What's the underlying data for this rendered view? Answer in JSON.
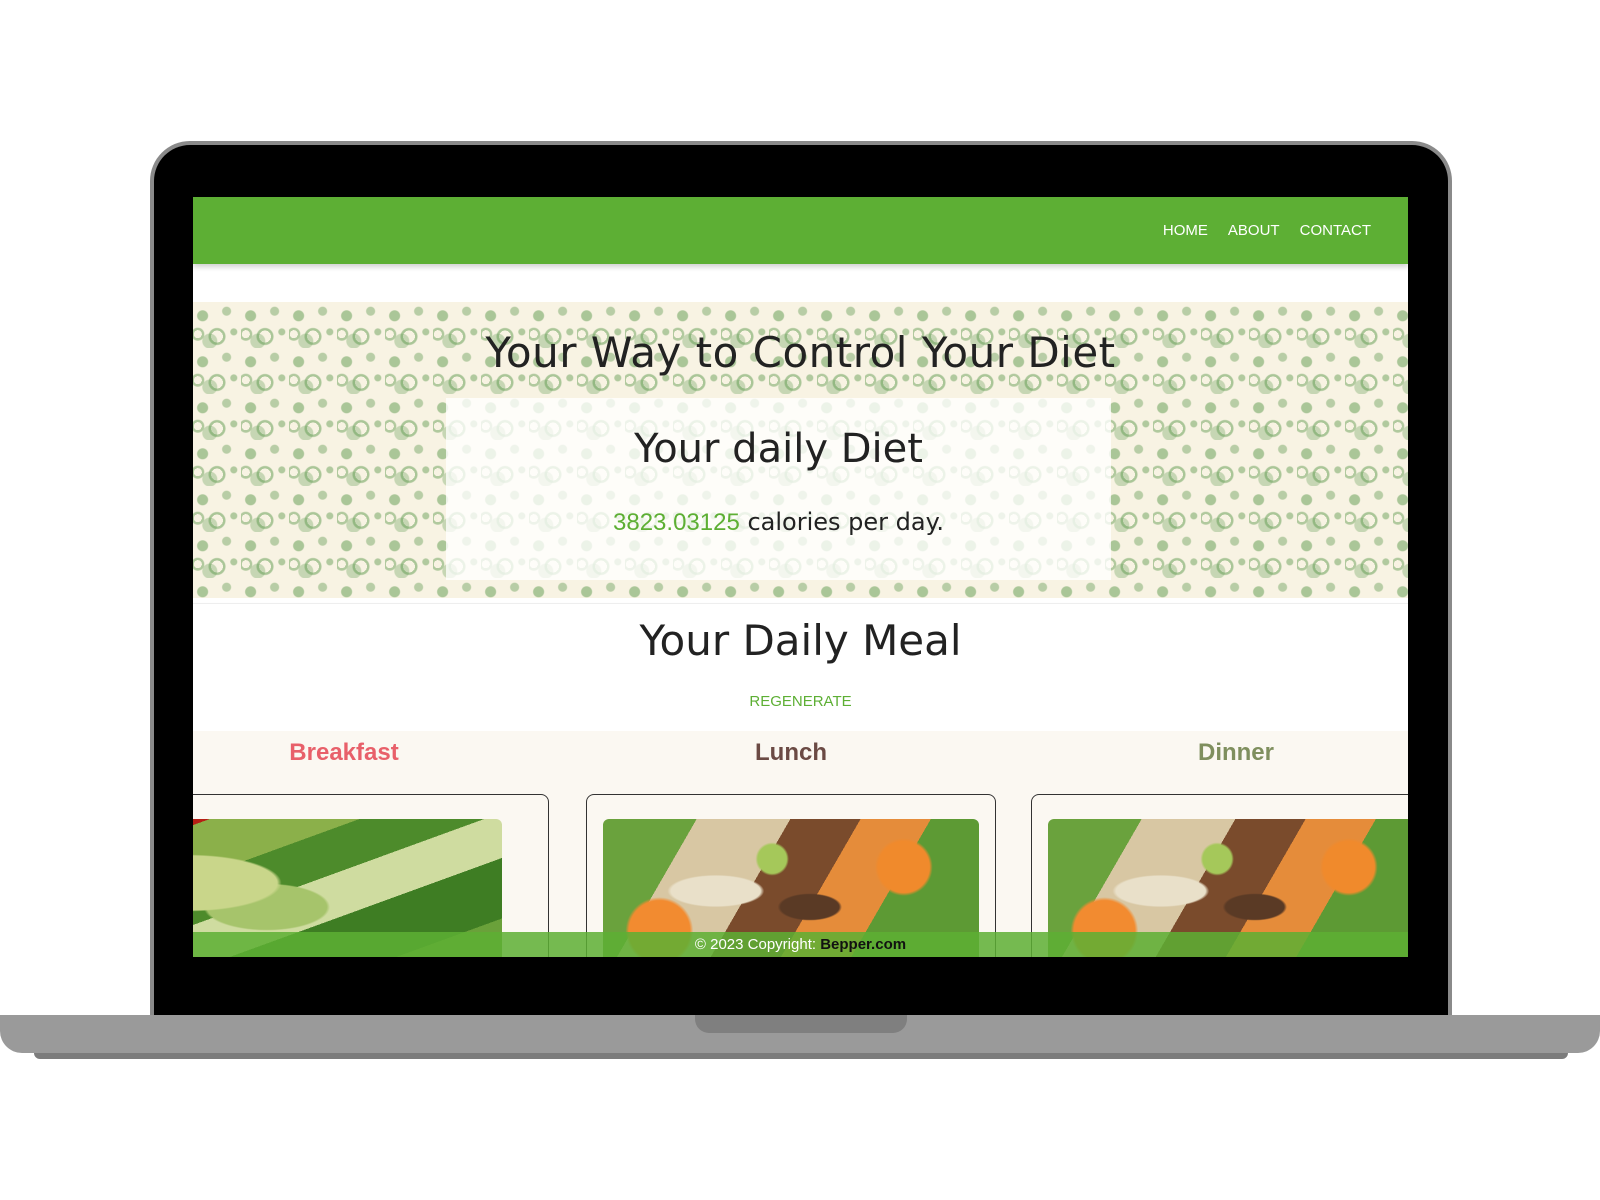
{
  "nav": {
    "items": [
      {
        "label": "HOME"
      },
      {
        "label": "ABOUT"
      },
      {
        "label": "CONTACT"
      }
    ]
  },
  "hero": {
    "title": "Your Way to Control Your Diet",
    "card": {
      "title": "Your daily Diet",
      "calories": "3823.03125",
      "calories_suffix": " calories per day."
    }
  },
  "meal_section": {
    "title": "Your Daily Meal",
    "regenerate_label": "REGENERATE"
  },
  "meals": [
    {
      "label": "Breakfast",
      "color": "#e8606a"
    },
    {
      "label": "Lunch",
      "color": "#6b4a44"
    },
    {
      "label": "Dinner",
      "color": "#7f8f5e"
    }
  ],
  "footer": {
    "copyright": "© 2023 Copyright: ",
    "brand": "Bepper.com"
  },
  "colors": {
    "accent": "#5daf34",
    "hero_background": "#f8f3e3"
  }
}
